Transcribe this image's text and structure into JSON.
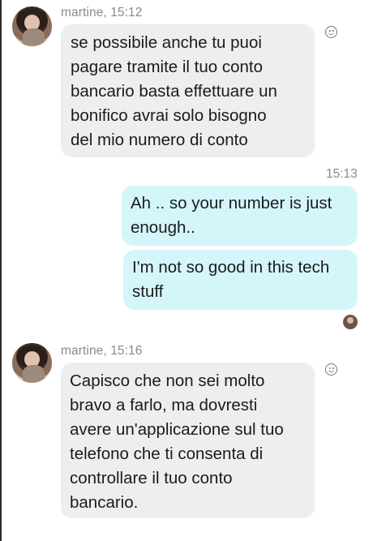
{
  "conversation": {
    "messages": [
      {
        "sender_line": "martine, 15:12",
        "text": "se possibile anche tu puoi\npagare tramite il tuo conto\nbancario basta effettuare un\nbonifico avrai solo bisogno\ndel mio numero di conto"
      },
      {
        "timestamp": "15:13"
      },
      {
        "text": "Ah .. so your number is just\nenough.."
      },
      {
        "text": "I'm not so good in this tech\nstuff"
      },
      {
        "sender_line": "martine, 15:16",
        "text": "Capisco che non sei molto\nbravo a farlo, ma dovresti\navere un'applicazione sul tuo\ntelefono che ti consenta di\ncontrollare il tuo conto\nbancario."
      }
    ]
  },
  "icons": {
    "reaction": "smiley-reaction-icon",
    "avatar": "contact-avatar",
    "read_receipt": "read-receipt-avatar"
  },
  "colors": {
    "incoming_bubble": "#eeeeee",
    "outgoing_bubble": "#d4f6fb",
    "meta_text": "#8a8a8a"
  }
}
